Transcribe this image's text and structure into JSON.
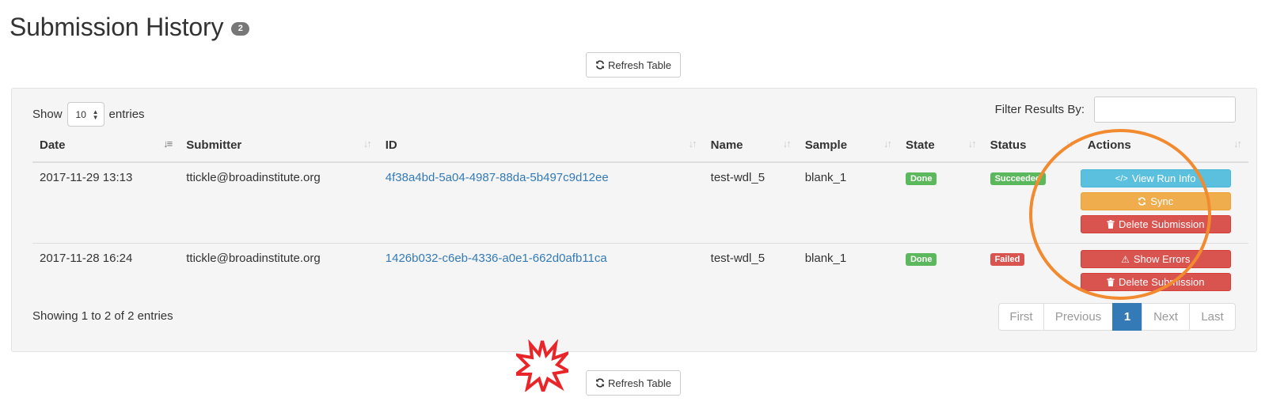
{
  "page": {
    "title": "Submission History",
    "count_badge": "2",
    "refresh_label": "Refresh Table"
  },
  "controls": {
    "show_label": "Show",
    "entries_value": "10",
    "entries_label": "entries",
    "filter_label": "Filter Results By:",
    "filter_value": ""
  },
  "table": {
    "columns": [
      "Date",
      "Submitter",
      "ID",
      "Name",
      "Sample",
      "State",
      "Status",
      "Actions"
    ],
    "sorted_column": "Date",
    "rows": [
      {
        "date": "2017-11-29 13:13",
        "submitter": "ttickle@broadinstitute.org",
        "id": "4f38a4bd-5a04-4987-88da-5b497c9d12ee",
        "name": "test-wdl_5",
        "sample": "blank_1",
        "state": "Done",
        "status": "Succeeded",
        "actions": [
          "View Run Info",
          "Sync",
          "Delete Submission"
        ]
      },
      {
        "date": "2017-11-28 16:24",
        "submitter": "ttickle@broadinstitute.org",
        "id": "1426b032-c6eb-4336-a0e1-662d0afb11ca",
        "name": "test-wdl_5",
        "sample": "blank_1",
        "state": "Done",
        "status": "Failed",
        "actions": [
          "Show Errors",
          "Delete Submission"
        ]
      }
    ]
  },
  "footer": {
    "showing_text": "Showing 1 to 2 of 2 entries",
    "pagination": {
      "first": "First",
      "previous": "Previous",
      "current": "1",
      "next": "Next",
      "last": "Last"
    }
  },
  "colors": {
    "done": "#5cb85c",
    "succeeded": "#5cb85c",
    "failed": "#d9534f",
    "info": "#5bc0de",
    "warning": "#f0ad4e",
    "danger": "#d9534f",
    "link": "#337ab7",
    "annotation_ellipse": "#f28a30",
    "annotation_starburst": "#e8262a"
  },
  "icons": {
    "refresh": "refresh-icon",
    "code": "code-icon",
    "sync": "sync-icon",
    "trash": "trash-icon",
    "warning": "warning-icon",
    "sort": "sort-icon"
  }
}
